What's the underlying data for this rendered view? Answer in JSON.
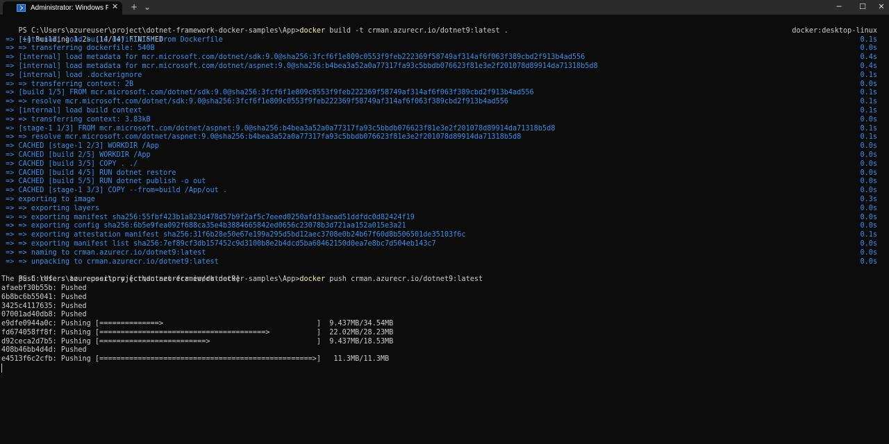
{
  "window": {
    "tab_title": "Administrator: Windows PowerShell",
    "tab_close": "✕",
    "new_tab": "+",
    "dropdown": "⌄",
    "minimize": "─",
    "maximize": "☐",
    "close": "✕"
  },
  "terminal": {
    "prompt1": "PS C:\\Users\\azureuser\\project\\dotnet-framework-docker-samples\\App>",
    "cmd1_word": "docker",
    "cmd1_rest": " build -t crman.azurecr.io/dotnet9:latest .",
    "build_status": "[+] Building 1.2s (14/14) FINISHED",
    "builder": "docker:desktop-linux",
    "build_steps": [
      {
        "text": " => [internal] load build definition from Dockerfile",
        "time": "0.1s"
      },
      {
        "text": " => => transferring dockerfile: 540B",
        "time": "0.0s"
      },
      {
        "text": " => [internal] load metadata for mcr.microsoft.com/dotnet/sdk:9.0@sha256:3fcf6f1e809c0553f9feb222369f58749af314af6f063f389cbd2f913b4ad556",
        "time": "0.4s"
      },
      {
        "text": " => [internal] load metadata for mcr.microsoft.com/dotnet/aspnet:9.0@sha256:b4bea3a52a0a77317fa93c5bbdb076623f81e3e2f201078d89914da71318b5d8",
        "time": "0.4s"
      },
      {
        "text": " => [internal] load .dockerignore",
        "time": "0.1s"
      },
      {
        "text": " => => transferring context: 2B",
        "time": "0.0s"
      },
      {
        "text": " => [build 1/5] FROM mcr.microsoft.com/dotnet/sdk:9.0@sha256:3fcf6f1e809c0553f9feb222369f58749af314af6f063f389cbd2f913b4ad556",
        "time": "0.1s"
      },
      {
        "text": " => => resolve mcr.microsoft.com/dotnet/sdk:9.0@sha256:3fcf6f1e809c0553f9feb222369f58749af314af6f063f389cbd2f913b4ad556",
        "time": "0.1s"
      },
      {
        "text": " => [internal] load build context",
        "time": "0.1s"
      },
      {
        "text": " => => transferring context: 3.83kB",
        "time": "0.0s"
      },
      {
        "text": " => [stage-1 1/3] FROM mcr.microsoft.com/dotnet/aspnet:9.0@sha256:b4bea3a52a0a77317fa93c5bbdb076623f81e3e2f201078d89914da71318b5d8",
        "time": "0.1s"
      },
      {
        "text": " => => resolve mcr.microsoft.com/dotnet/aspnet:9.0@sha256:b4bea3a52a0a77317fa93c5bbdb076623f81e3e2f201078d89914da71318b5d8",
        "time": "0.1s"
      },
      {
        "text": " => CACHED [stage-1 2/3] WORKDIR /App",
        "time": "0.0s"
      },
      {
        "text": " => CACHED [build 2/5] WORKDIR /App",
        "time": "0.0s"
      },
      {
        "text": " => CACHED [build 3/5] COPY . ./",
        "time": "0.0s"
      },
      {
        "text": " => CACHED [build 4/5] RUN dotnet restore",
        "time": "0.0s"
      },
      {
        "text": " => CACHED [build 5/5] RUN dotnet publish -o out",
        "time": "0.0s"
      },
      {
        "text": " => CACHED [stage-1 3/3] COPY --from=build /App/out .",
        "time": "0.0s"
      },
      {
        "text": " => exporting to image",
        "time": "0.3s"
      },
      {
        "text": " => => exporting layers",
        "time": "0.0s"
      },
      {
        "text": " => => exporting manifest sha256:55fbf423b1a823d478d57b9f2af5c7eeed0250afd33aead51ddfdc0d82424f19",
        "time": "0.0s"
      },
      {
        "text": " => => exporting config sha256:6b5e9fea092f688ca35e4b3884665842ed0656c23078b3d721aa152a015e3a21",
        "time": "0.0s"
      },
      {
        "text": " => => exporting attestation manifest sha256:31f6b28e50e67e199a295d5bd12aec3708e0b24b67f60d8b506501de35103f6c",
        "time": "0.1s"
      },
      {
        "text": " => => exporting manifest list sha256:7ef89cf3db157452c9d3100b8e2b4dcd5ba60462150d0ea7e8bc7d504eb143c7",
        "time": "0.0s"
      },
      {
        "text": " => => naming to crman.azurecr.io/dotnet9:latest",
        "time": "0.0s"
      },
      {
        "text": " => => unpacking to crman.azurecr.io/dotnet9:latest",
        "time": "0.0s"
      }
    ],
    "prompt2": "PS C:\\Users\\azureuser\\project\\dotnet-framework-docker-samples\\App>",
    "cmd2_word": "docker",
    "cmd2_rest": " push crman.azurecr.io/dotnet9:latest",
    "push_lines": [
      "The push refers to repository [crman.azurecr.io/dotnet9]",
      "afaebf30b55b: Pushed",
      "6b8bc6b55041: Pushed",
      "3425c4117635: Pushed",
      "07001ad40db8: Pushed",
      "e9dfe0944a0c: Pushing [==============>                                    ]  9.437MB/34.54MB",
      "fd674058ff8f: Pushing [=======================================>           ]  22.02MB/28.23MB",
      "d92ceca2d7b5: Pushing [=========================>                         ]  9.437MB/18.53MB",
      "408b46bb4d4d: Pushed",
      "e4513f6c2cfb: Pushing [==================================================>]   11.3MB/11.3MB"
    ]
  }
}
